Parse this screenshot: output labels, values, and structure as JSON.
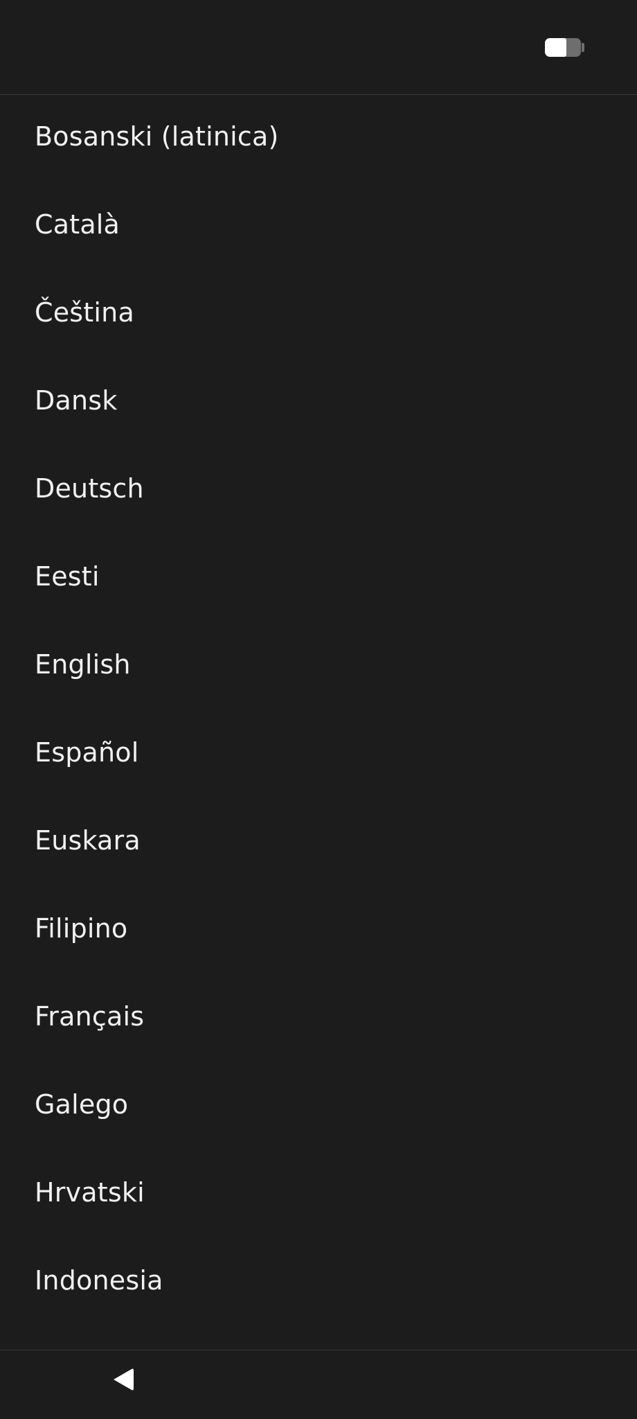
{
  "status_bar": {
    "battery_icon": "battery-icon",
    "battery_level": 0.6
  },
  "languages": [
    {
      "label": "Bosanski (latinica)"
    },
    {
      "label": "Català"
    },
    {
      "label": "Čeština"
    },
    {
      "label": "Dansk"
    },
    {
      "label": "Deutsch"
    },
    {
      "label": "Eesti"
    },
    {
      "label": "English"
    },
    {
      "label": "Español"
    },
    {
      "label": "Euskara"
    },
    {
      "label": "Filipino"
    },
    {
      "label": "Français"
    },
    {
      "label": "Galego"
    },
    {
      "label": "Hrvatski"
    },
    {
      "label": "Indonesia"
    }
  ],
  "nav_bar": {
    "back_icon": "back-triangle-icon"
  },
  "colors": {
    "background": "#1c1c1c",
    "text": "#f1f1f1",
    "divider": "#3a3a3a"
  }
}
